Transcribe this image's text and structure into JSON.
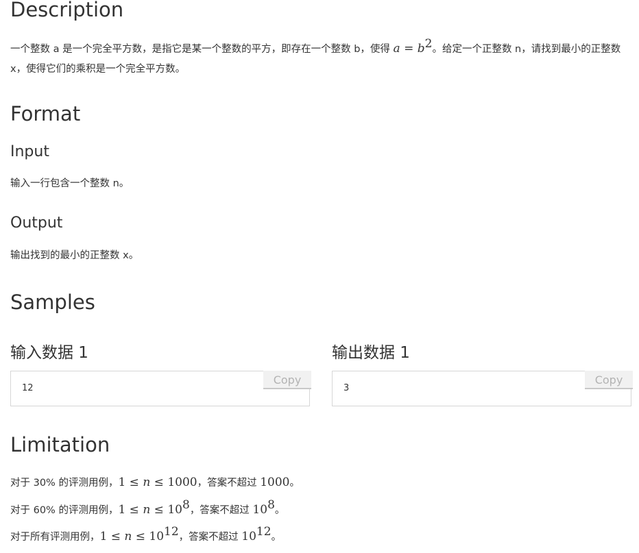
{
  "description": {
    "title": "Description",
    "text_a": "一个整数 a 是一个完全平方数，是指它是某一个整数的平方，即存在一个整数 b，使得 ",
    "math_a": "a",
    "math_eq": " = ",
    "math_b": "b",
    "math_exp": "2",
    "text_b": "。给定一个正整数 n，请找到最小的正整数 x，使得它们的乘积是一个完全平方数。"
  },
  "format": {
    "title": "Format",
    "input_title": "Input",
    "input_text": "输入一行包含一个整数 n。",
    "output_title": "Output",
    "output_text": "输出找到的最小的正整数 x。"
  },
  "samples": {
    "title": "Samples",
    "input_label": "输入数据 1",
    "input_value": "12",
    "output_label": "输出数据 1",
    "output_value": "3",
    "copy_label": "Copy"
  },
  "limitation": {
    "title": "Limitation",
    "lines": [
      {
        "prefix": "对于 30% 的评测用例，",
        "range_start": "1 ≤ ",
        "var": "n",
        "range_mid": " ≤ ",
        "bound": "1000",
        "bound_exp": "",
        "mid": "，答案不超过 ",
        "ans": "1000",
        "ans_exp": "",
        "end": "。"
      },
      {
        "prefix": "对于 60% 的评测用例，",
        "range_start": "1 ≤ ",
        "var": "n",
        "range_mid": " ≤ ",
        "bound": "10",
        "bound_exp": "8",
        "mid": "，答案不超过 ",
        "ans": "10",
        "ans_exp": "8",
        "end": "。"
      },
      {
        "prefix": "对于所有评测用例，",
        "range_start": "1 ≤ ",
        "var": "n",
        "range_mid": " ≤ ",
        "bound": "10",
        "bound_exp": "12",
        "mid": "，答案不超过 ",
        "ans": "10",
        "ans_exp": "12",
        "end": "。"
      }
    ]
  }
}
